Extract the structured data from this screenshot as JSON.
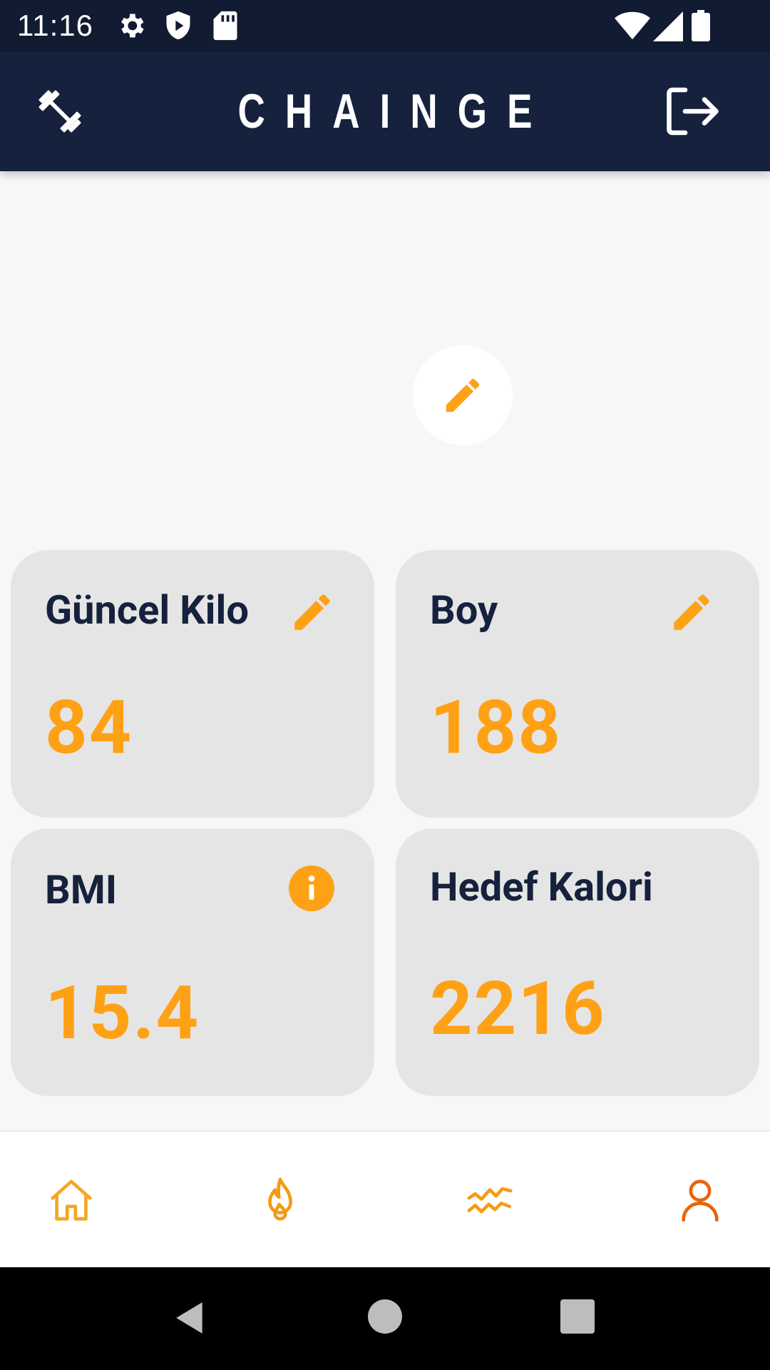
{
  "status_bar": {
    "time": "11:16",
    "left_icons": [
      "gear-icon",
      "shield-play-icon",
      "sd-card-icon"
    ],
    "right_icons": [
      "wifi-icon",
      "signal-icon",
      "battery-icon"
    ]
  },
  "app_bar": {
    "title": "CHAINGE",
    "left_icon": "dumbbell-icon",
    "right_icon": "logout-icon",
    "background": "#15213D"
  },
  "profile": {
    "edit_icon": "pencil-icon"
  },
  "cards": [
    {
      "title": "Güncel Kilo",
      "value": "84",
      "icon": "pencil-icon"
    },
    {
      "title": "Boy",
      "value": "188",
      "icon": "pencil-icon"
    },
    {
      "title": "BMI",
      "value": "15.4",
      "icon": "info-icon"
    },
    {
      "title": "Hedef Kalori",
      "value": "2216",
      "icon": null
    }
  ],
  "bottom_nav": {
    "items": [
      {
        "icon": "home-icon"
      },
      {
        "icon": "flame-icon"
      },
      {
        "icon": "trend-lines-icon"
      },
      {
        "icon": "user-icon"
      }
    ],
    "colors": {
      "home": "#F5A623",
      "flame": "#F39C12",
      "trend": "#F39C12",
      "user": "#E8650A"
    }
  },
  "colors": {
    "accent": "#FFA114",
    "navy": "#15213D",
    "card_bg": "#E5E5E5",
    "page_bg": "#F7F7F7"
  },
  "system_nav": [
    "back-icon",
    "home-circle-icon",
    "recents-icon"
  ]
}
